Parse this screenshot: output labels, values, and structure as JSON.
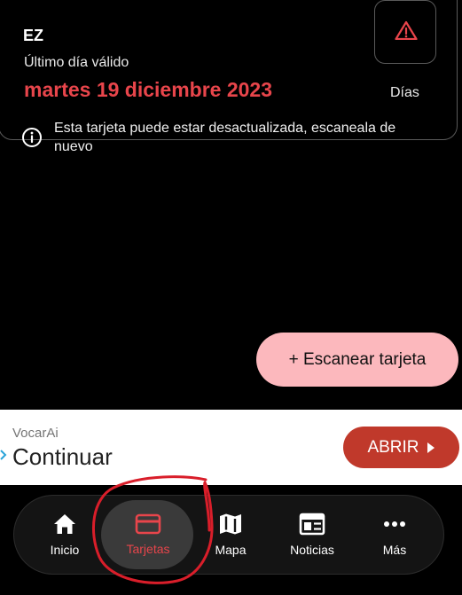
{
  "card": {
    "top_text": "EZ",
    "valid_label": "Último día válido",
    "valid_date": "martes 19 diciembre 2023",
    "days_label": "Días",
    "info_text": "Esta tarjeta puede estar desactualizada, escaneala de nuevo"
  },
  "fab": {
    "label": "+ Escanear tarjeta"
  },
  "ad": {
    "brand": "VocarAi",
    "title": "Continuar",
    "button_label": "ABRIR"
  },
  "nav": {
    "items": [
      {
        "label": "Inicio",
        "icon": "home-icon"
      },
      {
        "label": "Tarjetas",
        "icon": "card-icon"
      },
      {
        "label": "Mapa",
        "icon": "map-icon"
      },
      {
        "label": "Noticias",
        "icon": "news-icon"
      },
      {
        "label": "Más",
        "icon": "more-icon"
      }
    ],
    "active_index": 1
  },
  "colors": {
    "accent_red": "#e8454b",
    "fab_pink": "#fcb8bd",
    "ad_button": "#c0392b",
    "annotation_red": "#d91e2a"
  }
}
